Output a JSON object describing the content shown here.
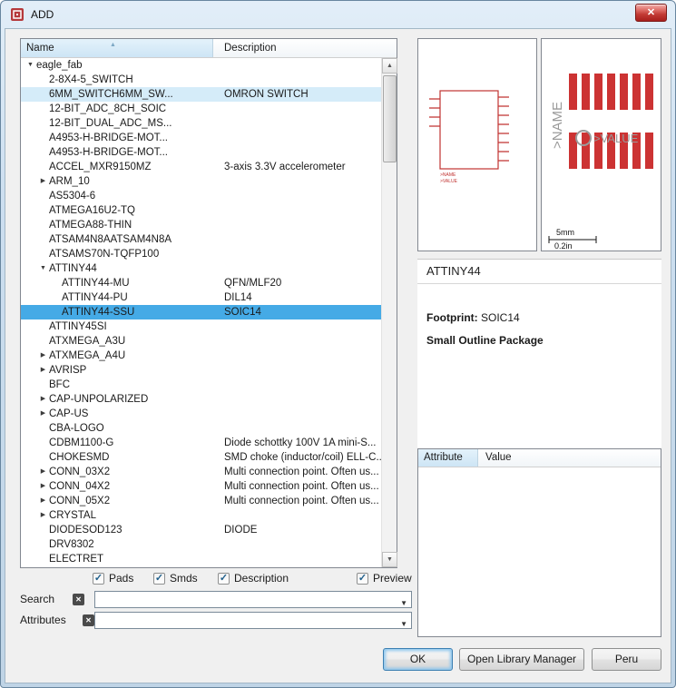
{
  "window": {
    "title": "ADD"
  },
  "icons": {
    "close": "✕",
    "sort_ascending": "▲",
    "expander_open": "▼",
    "expander_closed": "▶",
    "combo_arrow": "▼",
    "scroll_up": "▲",
    "scroll_down": "▼",
    "check": "✓",
    "clear": "✕"
  },
  "colors": {
    "selection_blue": "#45aae6",
    "hover_blue": "#d5ecf9",
    "eagle_red": "#c03331",
    "pad_red": "#cc3333",
    "silk_gray": "#9a9a9a"
  },
  "tree": {
    "columns": {
      "name": "Name",
      "description": "Description"
    },
    "items": [
      {
        "label": "eagle_fab",
        "desc": "",
        "indent": 0,
        "arrow": "down",
        "state": ""
      },
      {
        "label": "2-8X4-5_SWITCH",
        "desc": "",
        "indent": 1,
        "arrow": "",
        "state": ""
      },
      {
        "label": "6MM_SWITCH6MM_SW...",
        "desc": "OMRON SWITCH",
        "indent": 1,
        "arrow": "",
        "state": "hover"
      },
      {
        "label": "12-BIT_ADC_8CH_SOIC",
        "desc": "",
        "indent": 1,
        "arrow": "",
        "state": ""
      },
      {
        "label": "12-BIT_DUAL_ADC_MS...",
        "desc": "",
        "indent": 1,
        "arrow": "",
        "state": ""
      },
      {
        "label": "A4953-H-BRIDGE-MOT...",
        "desc": "",
        "indent": 1,
        "arrow": "",
        "state": ""
      },
      {
        "label": "A4953-H-BRIDGE-MOT...",
        "desc": "",
        "indent": 1,
        "arrow": "",
        "state": ""
      },
      {
        "label": "ACCEL_MXR9150MZ",
        "desc": "3-axis 3.3V accelerometer",
        "indent": 1,
        "arrow": "",
        "state": ""
      },
      {
        "label": "ARM_10",
        "desc": "",
        "indent": 1,
        "arrow": "right",
        "state": ""
      },
      {
        "label": "AS5304-6",
        "desc": "",
        "indent": 1,
        "arrow": "",
        "state": ""
      },
      {
        "label": "ATMEGA16U2-TQ",
        "desc": "",
        "indent": 1,
        "arrow": "",
        "state": ""
      },
      {
        "label": "ATMEGA88-THIN",
        "desc": "",
        "indent": 1,
        "arrow": "",
        "state": ""
      },
      {
        "label": "ATSAM4N8AATSAM4N8A",
        "desc": "",
        "indent": 1,
        "arrow": "",
        "state": ""
      },
      {
        "label": "ATSAMS70N-TQFP100",
        "desc": "",
        "indent": 1,
        "arrow": "",
        "state": ""
      },
      {
        "label": "ATTINY44",
        "desc": "",
        "indent": 1,
        "arrow": "down",
        "state": ""
      },
      {
        "label": "ATTINY44-MU",
        "desc": "QFN/MLF20",
        "indent": 2,
        "arrow": "",
        "state": ""
      },
      {
        "label": "ATTINY44-PU",
        "desc": "DIL14",
        "indent": 2,
        "arrow": "",
        "state": ""
      },
      {
        "label": "ATTINY44-SSU",
        "desc": "SOIC14",
        "indent": 2,
        "arrow": "",
        "state": "selected"
      },
      {
        "label": "ATTINY45SI",
        "desc": "",
        "indent": 1,
        "arrow": "",
        "state": ""
      },
      {
        "label": "ATXMEGA_A3U",
        "desc": "",
        "indent": 1,
        "arrow": "",
        "state": ""
      },
      {
        "label": "ATXMEGA_A4U",
        "desc": "",
        "indent": 1,
        "arrow": "right",
        "state": ""
      },
      {
        "label": "AVRISP",
        "desc": "",
        "indent": 1,
        "arrow": "right",
        "state": ""
      },
      {
        "label": "BFC",
        "desc": "",
        "indent": 1,
        "arrow": "",
        "state": ""
      },
      {
        "label": "CAP-UNPOLARIZED",
        "desc": "",
        "indent": 1,
        "arrow": "right",
        "state": ""
      },
      {
        "label": "CAP-US",
        "desc": "",
        "indent": 1,
        "arrow": "right",
        "state": ""
      },
      {
        "label": "CBA-LOGO",
        "desc": "",
        "indent": 1,
        "arrow": "",
        "state": ""
      },
      {
        "label": "CDBM1100-G",
        "desc": "Diode schottky 100V 1A mini-S...",
        "indent": 1,
        "arrow": "",
        "state": ""
      },
      {
        "label": "CHOKESMD",
        "desc": "SMD choke (inductor/coil) ELL-C...",
        "indent": 1,
        "arrow": "",
        "state": ""
      },
      {
        "label": "CONN_03X2",
        "desc": "Multi connection point. Often us...",
        "indent": 1,
        "arrow": "right",
        "state": ""
      },
      {
        "label": "CONN_04X2",
        "desc": "Multi connection point. Often us...",
        "indent": 1,
        "arrow": "right",
        "state": ""
      },
      {
        "label": "CONN_05X2",
        "desc": "Multi connection point. Often us...",
        "indent": 1,
        "arrow": "right",
        "state": ""
      },
      {
        "label": "CRYSTAL",
        "desc": "",
        "indent": 1,
        "arrow": "right",
        "state": ""
      },
      {
        "label": "DIODESOD123",
        "desc": "DIODE",
        "indent": 1,
        "arrow": "",
        "state": ""
      },
      {
        "label": "DRV8302",
        "desc": "",
        "indent": 1,
        "arrow": "",
        "state": ""
      },
      {
        "label": "ELECTRET",
        "desc": "",
        "indent": 1,
        "arrow": "",
        "state": ""
      }
    ]
  },
  "preview": {
    "symbol_labels": {
      "name": ">NAME",
      "value": ">VALUE"
    },
    "footprint_labels": {
      "name": ">NAME",
      "value": ">VALUE",
      "scale_mm": "5mm",
      "scale_in": "0.2in"
    }
  },
  "info": {
    "title": "ATTINY44",
    "footprint_label": "Footprint:",
    "footprint_value": "SOIC14",
    "package": "Small Outline Package"
  },
  "attributes_table": {
    "col_attribute": "Attribute",
    "col_value": "Value",
    "rows": []
  },
  "filters": {
    "checkboxes": [
      {
        "label": "Pads",
        "checked": true
      },
      {
        "label": "Smds",
        "checked": true
      },
      {
        "label": "Description",
        "checked": true
      },
      {
        "label": "Preview",
        "checked": true
      }
    ]
  },
  "search": {
    "label": "Search",
    "value": ""
  },
  "attributes_filter": {
    "label": "Attributes",
    "value": ""
  },
  "buttons": {
    "ok": "OK",
    "open_library_manager": "Open Library Manager",
    "peru": "Peru"
  }
}
